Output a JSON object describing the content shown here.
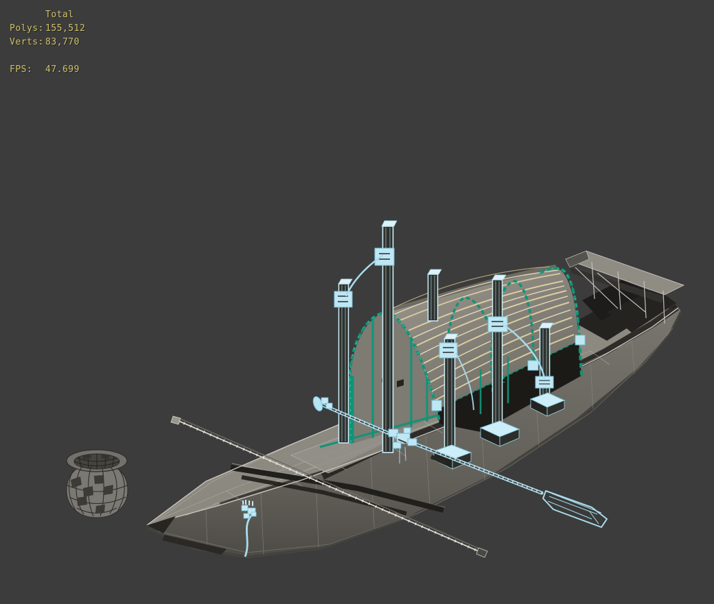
{
  "stats": {
    "header": "Total",
    "rows": [
      {
        "label": "Polys:",
        "value": "155,512"
      },
      {
        "label": "Verts:",
        "value": "83,770"
      }
    ],
    "fps": {
      "label": "FPS:",
      "value": "47.699"
    }
  },
  "colors": {
    "bg": "#3c3c3c",
    "statsText": "#cfc169",
    "teal": "#0f9477",
    "tealDark": "#0b7a61",
    "slatTan": "#dbcda2",
    "slatLight": "#e9dfba",
    "slatFar": "#b3a67e",
    "blue": "#a9dcee",
    "blueLight": "#cdeef8",
    "blueMid": "#bfe7f3",
    "blueStroke": "#7cc3d8",
    "wire": "#c9c6bd",
    "deckGray": "#8c8981",
    "wallGray": "#6b6861",
    "cabinGray": "#7e7b73",
    "shadowDark": "#1b1a17"
  },
  "scene": {
    "objects": [
      "boat-hull",
      "cabin-front-wall",
      "canopy",
      "masts",
      "ropes",
      "sculling-oar",
      "spare-oar",
      "clay-pot",
      "stern-platform"
    ]
  }
}
